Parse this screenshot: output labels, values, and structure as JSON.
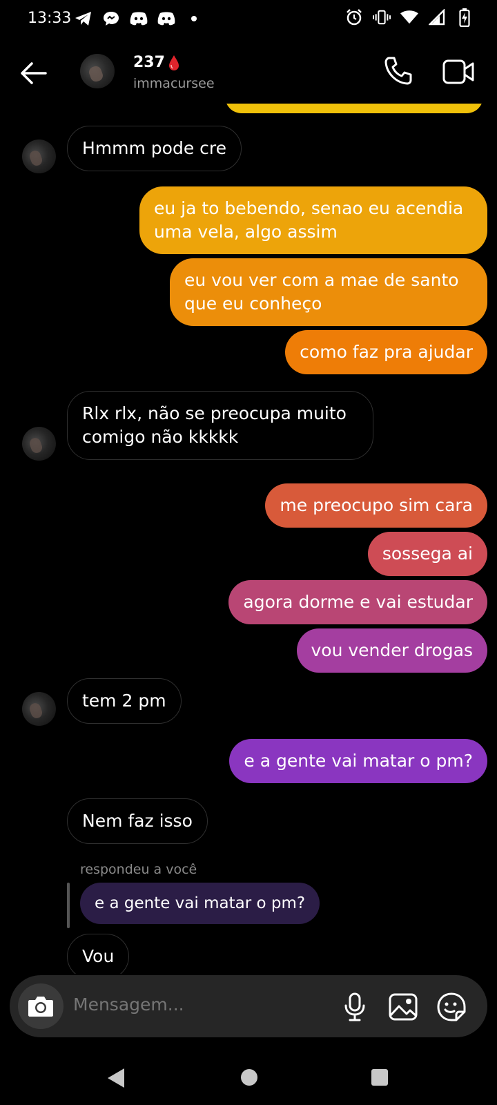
{
  "status_bar": {
    "time": "13:33",
    "left_icons": [
      "telegram-icon",
      "chat-bubble-icon",
      "discord-icon",
      "discord-icon",
      "dot-icon"
    ],
    "right_icons": [
      "alarm-icon",
      "vibrate-icon",
      "wifi-icon",
      "signal-icon",
      "battery-charging-icon"
    ]
  },
  "header": {
    "name": "237",
    "username": "immacursee",
    "name_emoji": "blood-drop"
  },
  "messages": [
    {
      "side": "in",
      "text": "Hmmm pode cre"
    },
    {
      "side": "out",
      "text": "eu ja to bebendo, senao eu acendia uma vela, algo assim",
      "color": "#eda40a"
    },
    {
      "side": "out",
      "text": "eu vou ver com a mae de santo que eu conheço",
      "color": "#ec8e0a"
    },
    {
      "side": "out",
      "text": "como faz pra ajudar",
      "color": "#ee7d07"
    },
    {
      "side": "in",
      "text": "Rlx rlx, não se preocupa muito comigo não kkkkk"
    },
    {
      "side": "out",
      "text": "me preocupo sim cara",
      "color": "#d85a3a"
    },
    {
      "side": "out",
      "text": "sossega ai",
      "color": "#ce4c55"
    },
    {
      "side": "out",
      "text": "agora dorme e vai estudar",
      "color": "#b94674"
    },
    {
      "side": "out",
      "text": "vou vender drogas",
      "color": "#a43ea0"
    },
    {
      "side": "in",
      "text": "tem 2 pm"
    },
    {
      "side": "out",
      "text": "e a gente vai matar o pm?",
      "color": "#8a36c0"
    },
    {
      "side": "in",
      "text": "Nem faz isso"
    },
    {
      "side": "in",
      "text": "Vou"
    }
  ],
  "reply": {
    "label": "respondeu a você",
    "quoted": "e a gente vai matar o pm?"
  },
  "composer": {
    "placeholder": "Mensagem..."
  },
  "colors": {
    "incoming_border": "#2f2f2f",
    "reply_bubble": "#2b1d46",
    "composer_bg": "#262626"
  }
}
